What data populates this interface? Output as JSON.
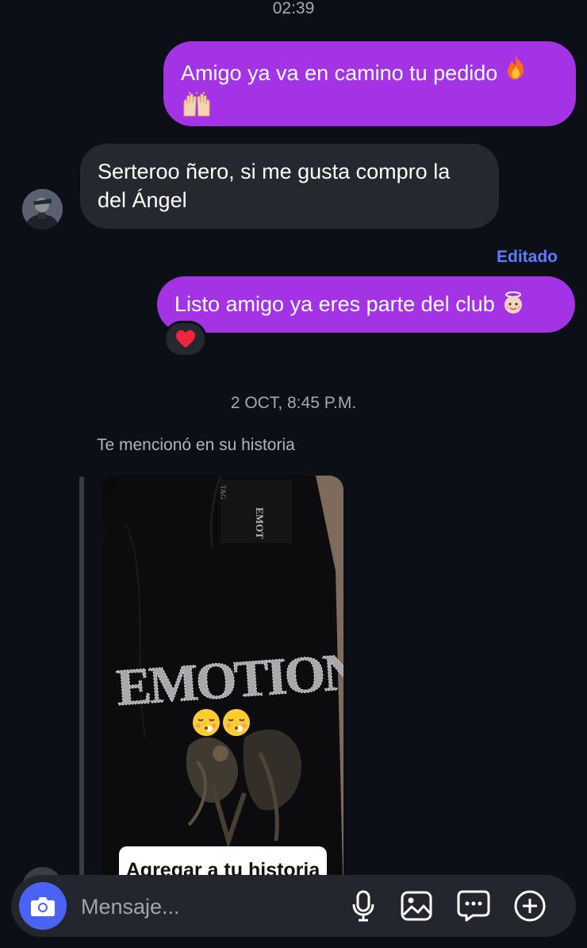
{
  "timestamps": {
    "top": "02:39",
    "middle": "2 OCT, 8:45 P.M."
  },
  "messages": [
    {
      "direction": "outgoing",
      "text_line1": "Amigo ya va en camino tu pedido",
      "emojis": [
        "fire-emoji",
        "raising-hands-emoji"
      ]
    },
    {
      "direction": "incoming",
      "text_line1": "Serteroo ñero, si me gusta compro la",
      "text_line2": "del Ángel"
    },
    {
      "direction": "outgoing",
      "text": "Listo amigo ya eres parte del club",
      "emojis": [
        "baby-angel-emoji"
      ],
      "edited_label": "Editado",
      "reaction": "red-heart"
    }
  ],
  "story_mention": {
    "label": "Te mencionó en su historia",
    "add_button": "Agregar a tu historia",
    "shirt_text": "EMOTION",
    "tag_text": "EMOT",
    "emojis": [
      "face-exhaling-emoji",
      "face-exhaling-emoji"
    ]
  },
  "composer": {
    "placeholder": "Mensaje...",
    "icons": [
      "camera-icon",
      "microphone-icon",
      "gallery-icon",
      "sticker-icon",
      "plus-icon"
    ]
  },
  "colors": {
    "background": "#0d0f17",
    "outgoing_bubble": "#a533e6",
    "incoming_bubble": "#26282f",
    "accent_blue": "#4b63f5",
    "edited_label": "#5b7cff"
  }
}
